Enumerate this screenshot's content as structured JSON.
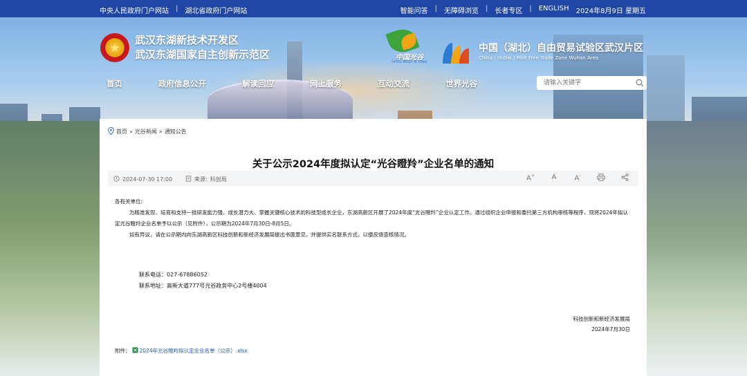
{
  "topbar": {
    "left_links": [
      "中央人民政府门户网站",
      "湖北省政府门户网站"
    ],
    "separator": "|",
    "right_links": [
      "智能问答",
      "无障碍浏览",
      "长者专区",
      "ENGLISH"
    ],
    "date": "2024年8月9日 星期五"
  },
  "header": {
    "zone_name_1": "武汉东湖新技术开发区",
    "zone_name_2": "武汉东湖国家自主创新示范区",
    "optics_valley_logo": "中国光谷",
    "optics_valley_logo_sub": "OPTICS VALLEY OF CHINA",
    "ftz_name_cn": "中国（湖北）自由贸易试验区武汉片区",
    "ftz_name_en": "China ( Hubei ) Pilot Free Trade Zone Wuhan Area"
  },
  "nav": {
    "items": [
      "首页",
      "政府信息公开",
      "解读回应",
      "网上服务",
      "互动交流",
      "世界光谷"
    ]
  },
  "search": {
    "placeholder": "请输入关键字"
  },
  "breadcrumb": {
    "items": [
      "首页",
      "光谷新闻",
      "通知公告"
    ],
    "separator": "»"
  },
  "article": {
    "title": "关于公示2024年度拟认定“光谷瞪羚”企业名单的通知",
    "date": "2024-07-30 17:00",
    "source_label": "来源:",
    "source": "科创局",
    "tools": [
      "A+",
      "A",
      "A-",
      "print",
      "share"
    ],
    "salutation": "各有关单位:",
    "paragraph_1": "为精准发现、培育和支持一批研发能力强、成长潜力大、掌握关键核心技术的科技型成长企业，东湖高新区开展了2024年度“光谷瞪羚”企业认定工作。通过组织企业申报和委托第三方机构审核等程序，现将2024年拟认定光谷瞪羚企业名单予以公示（见附件），公示期为2024年7月30日-8月5日。",
    "paragraph_2": "如有异议，请在公示期内向东湖高新区科技创新和新经济发展局提出书面意见，并提供实名联系方式，以便反馈查核情况。",
    "phone_label": "联系电话：",
    "phone": "027-67886052",
    "address_label": "联系地址：",
    "address": "高新大道777号光谷政务中心2号楼4004",
    "signer": "科技创新和新经济发展局",
    "sign_date": "2024年7月30日",
    "attachment_label": "附件：",
    "attachment_name": "2024年光谷瞪羚拟认定企业名单（公示）.xlsx"
  },
  "colors": {
    "topbar_bg": "#1f46a4",
    "link": "#1f5fb3"
  }
}
